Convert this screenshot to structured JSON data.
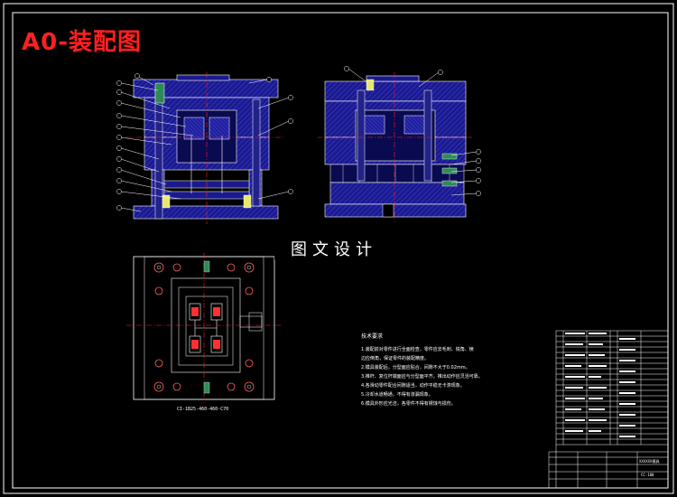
{
  "sheet": {
    "title": "A0-装配图",
    "watermark_text": "图文设计",
    "top_view_caption": "CI-1B25-460-460-C70",
    "colors": {
      "background": "#000000",
      "border": "#ffffff",
      "title": "#ff2020",
      "mold_plate": "#1a1a8c",
      "hatch": "#3a3ad0",
      "centerline": "#ff2020",
      "leader": "#ffffff",
      "callout": "#00ff80"
    }
  },
  "technical_requirements": {
    "heading": "技术要求",
    "lines": [
      "1.装配前对零件进行全面检查，零件应去毛刺、锐角、棱",
      "  边应倒角，保证零件的装配精度。",
      "2.模具装配后，分型面应贴合，间隙不大于0.02mm。",
      "3.推杆、复位杆端面应与分型面平齐，推出动作应灵活可靠。",
      "4.各滑动零件配合间隙适当，动作平稳无卡滞现象。",
      "5.冷却水道畅通，不得有渗漏现象。",
      "6.模具外形应光洁，各零件不得有锈蚀与损伤。"
    ]
  },
  "title_block": {
    "drawing_number": "CC-180",
    "part_name": "XXXXXX模具"
  }
}
